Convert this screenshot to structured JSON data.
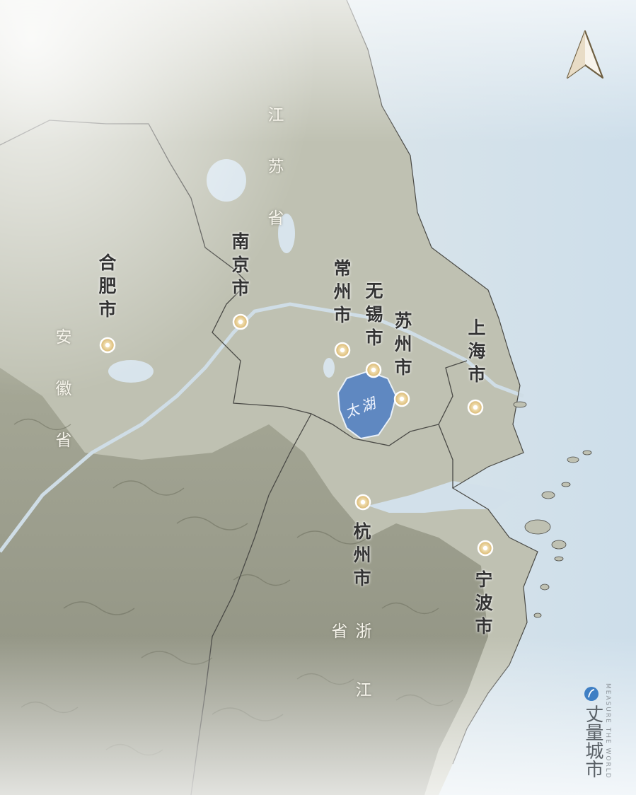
{
  "colors": {
    "land": "#bfc1b2",
    "sea": "#d3e2ec",
    "lake": "#5f88c1",
    "border": "#4a4a46",
    "marker": "#d9b874"
  },
  "icons": {
    "north_arrow": "north-arrow-icon",
    "brand_logo": "brand-logo-icon",
    "city_marker": "city-marker-icon"
  },
  "provinces": {
    "jiangsu": "江苏省",
    "anhui": "安徽省",
    "zhejiang": "浙江省"
  },
  "cities": {
    "nanjing": "南京市",
    "hefei": "合肥市",
    "changzhou": "常州市",
    "wuxi": "无锡市",
    "suzhou": "苏州市",
    "shanghai": "上海市",
    "hangzhou": "杭州市",
    "ningbo": "宁波市"
  },
  "lake": {
    "name": "太湖"
  },
  "brand": {
    "name": "丈量城市",
    "tagline": "MEASURE THE WORLD"
  }
}
